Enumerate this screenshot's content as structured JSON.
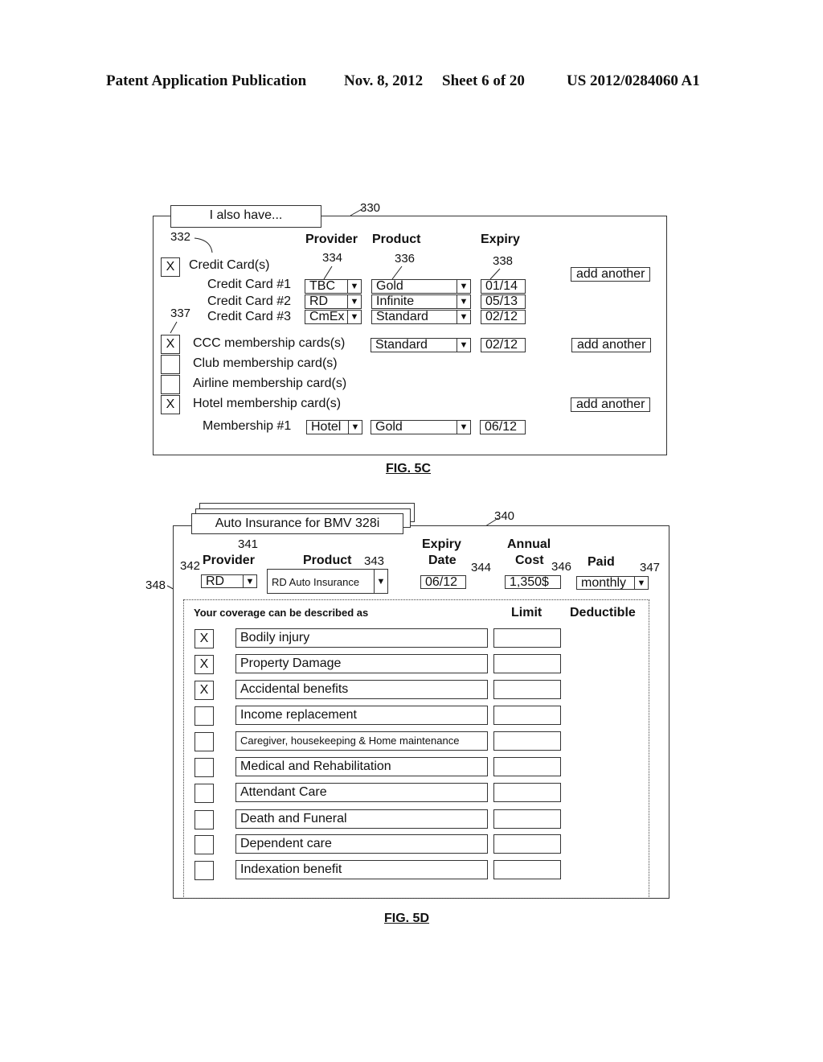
{
  "header": {
    "publication": "Patent Application Publication",
    "date": "Nov. 8, 2012",
    "sheet": "Sheet 6 of 20",
    "number": "US 2012/0284060 A1"
  },
  "fig5c": {
    "caption": "FIG. 5C",
    "tab_label": "I also have...",
    "refs": {
      "panel": "330",
      "credit": "332",
      "provider": "334",
      "product": "336",
      "ccc": "337",
      "expiry": "338"
    },
    "columns": {
      "provider": "Provider",
      "product": "Product",
      "expiry": "Expiry"
    },
    "add_another": "add another",
    "categories": [
      {
        "checked": "X",
        "label": "Credit Card(s)"
      },
      {
        "checked": "X",
        "label": "CCC membership cards(s)",
        "product": "Standard",
        "expiry": "02/12"
      },
      {
        "checked": "",
        "label": "Club membership card(s)"
      },
      {
        "checked": "",
        "label": "Airline membership card(s)"
      },
      {
        "checked": "X",
        "label": "Hotel membership card(s)"
      }
    ],
    "credit_cards": [
      {
        "label": "Credit Card #1",
        "provider": "TBC",
        "product": "Gold",
        "expiry": "01/14"
      },
      {
        "label": "Credit Card #2",
        "provider": "RD",
        "product": "Infinite",
        "expiry": "05/13"
      },
      {
        "label": "Credit Card #3",
        "provider": "CmEx",
        "product": "Standard",
        "expiry": "02/12"
      }
    ],
    "membership": {
      "label": "Membership #1",
      "provider": "Hotel",
      "product": "Gold",
      "expiry": "06/12"
    }
  },
  "fig5d": {
    "caption": "FIG. 5D",
    "tab_label": "Auto Insurance for BMV 328i",
    "refs": {
      "panel": "340",
      "tab": "341",
      "provider": "342",
      "product": "343",
      "expiry": "344",
      "cost": "346",
      "paid": "347",
      "coverage": "348"
    },
    "columns": {
      "provider": "Provider",
      "product": "Product",
      "expiry_1": "Expiry",
      "expiry_2": "Date",
      "cost_1": "Annual",
      "cost_2": "Cost",
      "paid": "Paid"
    },
    "values": {
      "provider": "RD",
      "product": "RD Auto Insurance",
      "expiry": "06/12",
      "cost": "1,350$",
      "paid": "monthly"
    },
    "coverage_title": "Your coverage can be described as",
    "limit_header": "Limit",
    "deductible_header": "Deductible",
    "coverages": [
      {
        "checked": "X",
        "label": "Bodily injury",
        "limit": ""
      },
      {
        "checked": "X",
        "label": "Property Damage",
        "limit": ""
      },
      {
        "checked": "X",
        "label": "Accidental benefits",
        "limit": ""
      },
      {
        "checked": "",
        "label": "Income replacement",
        "limit": ""
      },
      {
        "checked": "",
        "label": "Caregiver, housekeeping & Home maintenance",
        "limit": ""
      },
      {
        "checked": "",
        "label": "Medical and Rehabilitation",
        "limit": ""
      },
      {
        "checked": "",
        "label": "Attendant Care",
        "limit": ""
      },
      {
        "checked": "",
        "label": "Death and Funeral",
        "limit": ""
      },
      {
        "checked": "",
        "label": "Dependent care",
        "limit": ""
      },
      {
        "checked": "",
        "label": "Indexation benefit",
        "limit": ""
      }
    ]
  }
}
